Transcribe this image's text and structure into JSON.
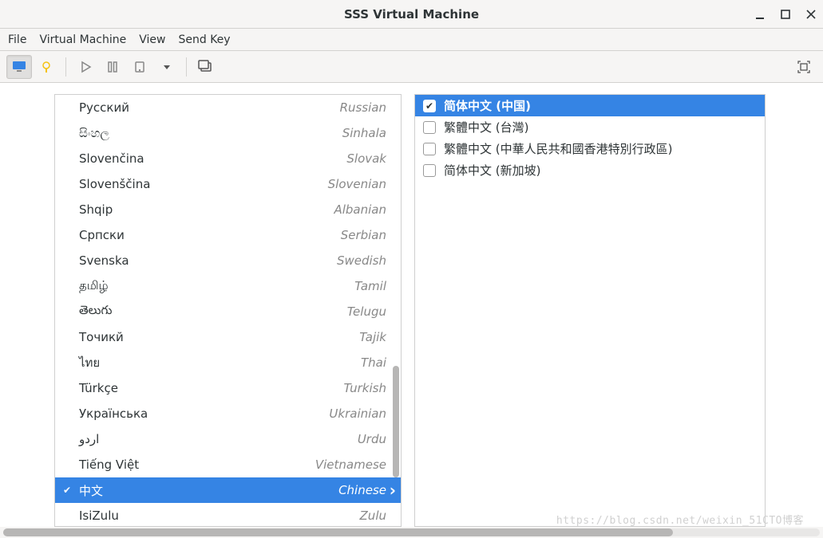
{
  "window": {
    "title": "SSS Virtual Machine"
  },
  "menu": {
    "file": "File",
    "vm": "Virtual Machine",
    "view": "View",
    "sendkey": "Send Key"
  },
  "langs": [
    {
      "native": "Русский",
      "eng": "Russian",
      "sel": false
    },
    {
      "native": "සිංහල",
      "eng": "Sinhala",
      "sel": false
    },
    {
      "native": "Slovenčina",
      "eng": "Slovak",
      "sel": false
    },
    {
      "native": "Slovenščina",
      "eng": "Slovenian",
      "sel": false
    },
    {
      "native": "Shqip",
      "eng": "Albanian",
      "sel": false
    },
    {
      "native": "Српски",
      "eng": "Serbian",
      "sel": false
    },
    {
      "native": "Svenska",
      "eng": "Swedish",
      "sel": false
    },
    {
      "native": "தமிழ்",
      "eng": "Tamil",
      "sel": false
    },
    {
      "native": "తెలుగు",
      "eng": "Telugu",
      "sel": false
    },
    {
      "native": "Точикй",
      "eng": "Tajik",
      "sel": false
    },
    {
      "native": "ไทย",
      "eng": "Thai",
      "sel": false
    },
    {
      "native": "Türkçe",
      "eng": "Turkish",
      "sel": false
    },
    {
      "native": "Українська",
      "eng": "Ukrainian",
      "sel": false
    },
    {
      "native": "اردو",
      "eng": "Urdu",
      "sel": false
    },
    {
      "native": "Tiếng Việt",
      "eng": "Vietnamese",
      "sel": false
    },
    {
      "native": "中文",
      "eng": "Chinese",
      "sel": true
    },
    {
      "native": "IsiZulu",
      "eng": "Zulu",
      "sel": false
    }
  ],
  "locales": [
    {
      "label": "简体中文 (中国)",
      "checked": true,
      "sel": true
    },
    {
      "label": "繁體中文 (台灣)",
      "checked": false,
      "sel": false
    },
    {
      "label": "繁體中文 (中華人民共和國香港特別行政區)",
      "checked": false,
      "sel": false
    },
    {
      "label": "简体中文 (新加坡)",
      "checked": false,
      "sel": false
    }
  ],
  "watermark": "https://blog.csdn.net/weixin_51CTO博客"
}
